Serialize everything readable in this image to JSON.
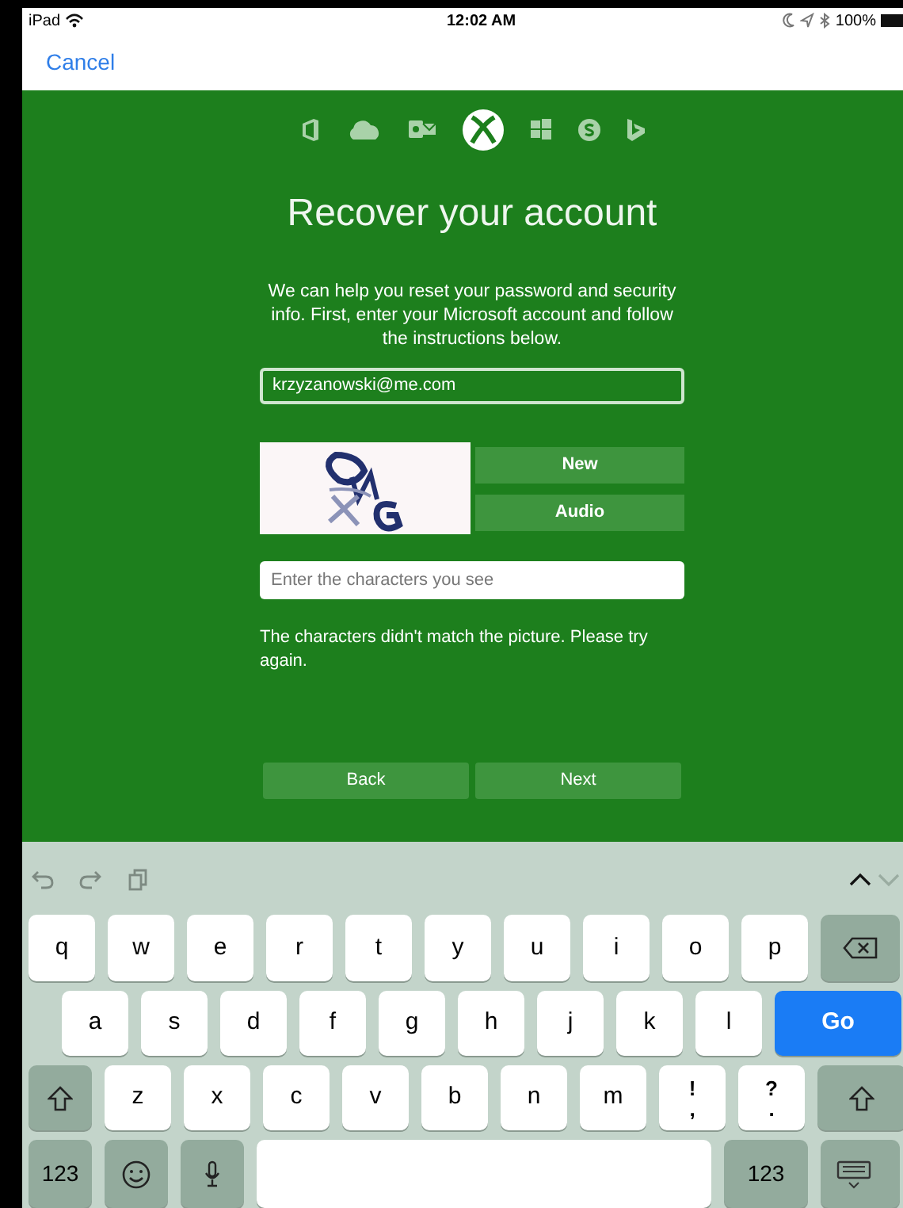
{
  "status_bar": {
    "device": "iPad",
    "time": "12:02 AM",
    "battery": "100%"
  },
  "nav": {
    "cancel": "Cancel"
  },
  "products": [
    {
      "kind": "office",
      "selected": false
    },
    {
      "kind": "cloud",
      "selected": false
    },
    {
      "kind": "mail",
      "selected": false
    },
    {
      "kind": "xbox",
      "selected": true
    },
    {
      "kind": "windows",
      "selected": false
    },
    {
      "kind": "skype",
      "selected": false
    },
    {
      "kind": "bing",
      "selected": false
    }
  ],
  "title": "Recover your account",
  "intro": "We can help you reset your password and security info. First, enter your Microsoft account and follow the instructions below.",
  "account_field": {
    "value": "krzyzanowski@me.com"
  },
  "captcha": {
    "buttons": [
      "New",
      "Audio"
    ]
  },
  "characters_field": {
    "placeholder": "Enter the characters you see"
  },
  "error": "The characters didn't match the picture. Please try again.",
  "buttons": [
    "Back",
    "Next"
  ],
  "keyboard": {
    "toolbar": [
      {
        "kind": "undo"
      },
      {
        "kind": "redo"
      },
      {
        "kind": "paste"
      }
    ],
    "arrows": [
      {
        "kind": "up",
        "disabled": false
      },
      {
        "kind": "down",
        "disabled": true
      }
    ],
    "rows": [
      {
        "keys": [
          {
            "kind": "letter",
            "label": "q"
          },
          {
            "kind": "letter",
            "label": "w"
          },
          {
            "kind": "letter",
            "label": "e"
          },
          {
            "kind": "letter",
            "label": "r"
          },
          {
            "kind": "letter",
            "label": "t"
          },
          {
            "kind": "letter",
            "label": "y"
          },
          {
            "kind": "letter",
            "label": "u"
          },
          {
            "kind": "letter",
            "label": "i"
          },
          {
            "kind": "letter",
            "label": "o"
          },
          {
            "kind": "letter",
            "label": "p"
          },
          {
            "kind": "delete"
          }
        ]
      },
      {
        "keys": [
          {
            "kind": "letter",
            "label": "a"
          },
          {
            "kind": "letter",
            "label": "s"
          },
          {
            "kind": "letter",
            "label": "d"
          },
          {
            "kind": "letter",
            "label": "f"
          },
          {
            "kind": "letter",
            "label": "g"
          },
          {
            "kind": "letter",
            "label": "h"
          },
          {
            "kind": "letter",
            "label": "j"
          },
          {
            "kind": "letter",
            "label": "k"
          },
          {
            "kind": "letter",
            "label": "l"
          },
          {
            "kind": "go",
            "label": "Go"
          }
        ]
      },
      {
        "keys": [
          {
            "kind": "shift"
          },
          {
            "kind": "letter",
            "label": "z"
          },
          {
            "kind": "letter",
            "label": "x"
          },
          {
            "kind": "letter",
            "label": "c"
          },
          {
            "kind": "letter",
            "label": "v"
          },
          {
            "kind": "letter",
            "label": "b"
          },
          {
            "kind": "letter",
            "label": "n"
          },
          {
            "kind": "letter",
            "label": "m"
          },
          {
            "kind": "dual",
            "top": "!",
            "bottom": ","
          },
          {
            "kind": "dual",
            "top": "?",
            "bottom": "."
          },
          {
            "kind": "shift"
          }
        ]
      },
      {
        "keys": [
          {
            "kind": "numbers",
            "label": "123"
          },
          {
            "kind": "emoji"
          },
          {
            "kind": "mic"
          },
          {
            "kind": "space"
          },
          {
            "kind": "numbers",
            "label": "123"
          },
          {
            "kind": "hide"
          }
        ]
      }
    ]
  }
}
